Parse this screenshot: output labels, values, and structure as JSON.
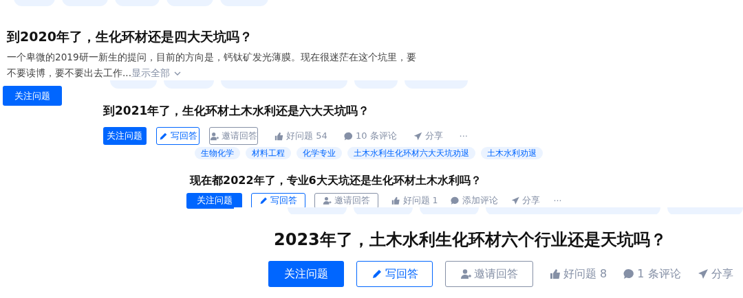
{
  "screenshots": [
    {
      "title": "到2020年了，生化环材还是四大天坑吗？",
      "description": "一个卑微的2019研一新生的提问，目前的方向是，钙钛矿发光薄膜。现在很迷茫在这个坑里，要不要读博，要不要出去工作...",
      "expand_link": "显示全部",
      "follow_button": "关注问题"
    },
    {
      "title": "到2021年了，生化环材土木水利还是六大天坑吗？",
      "follow_button": "关注问题",
      "answer_button": "写回答",
      "invite_button": "邀请回答",
      "actions": [
        {
          "kind": "like",
          "label": "好问题 54"
        },
        {
          "kind": "comment",
          "label": "10 条评论"
        },
        {
          "kind": "share",
          "label": "分享"
        },
        {
          "kind": "more",
          "label": "···"
        }
      ]
    },
    {
      "tags": [
        "生物化学",
        "材料工程",
        "化学专业",
        "土木水利生化环材六大天坑劝退",
        "土木水利劝退"
      ],
      "title": "现在都2022年了，专业6大天坑还是生化环材土木水利吗？",
      "follow_button": "关注问题",
      "answer_button": "写回答",
      "invite_button": "邀请回答",
      "actions": [
        {
          "kind": "like",
          "label": "好问题 1"
        },
        {
          "kind": "comment",
          "label": "添加评论"
        },
        {
          "kind": "share",
          "label": "分享"
        },
        {
          "kind": "more",
          "label": "···"
        }
      ]
    },
    {
      "title": "2023年了，土木水利生化环材六个行业还是天坑吗？",
      "follow_button": "关注问题",
      "answer_button": "写回答",
      "invite_button": "邀请回答",
      "actions": [
        {
          "kind": "like",
          "label": "好问题 8"
        },
        {
          "kind": "comment",
          "label": "1 条评论"
        },
        {
          "kind": "share",
          "label": "分享"
        }
      ]
    }
  ]
}
